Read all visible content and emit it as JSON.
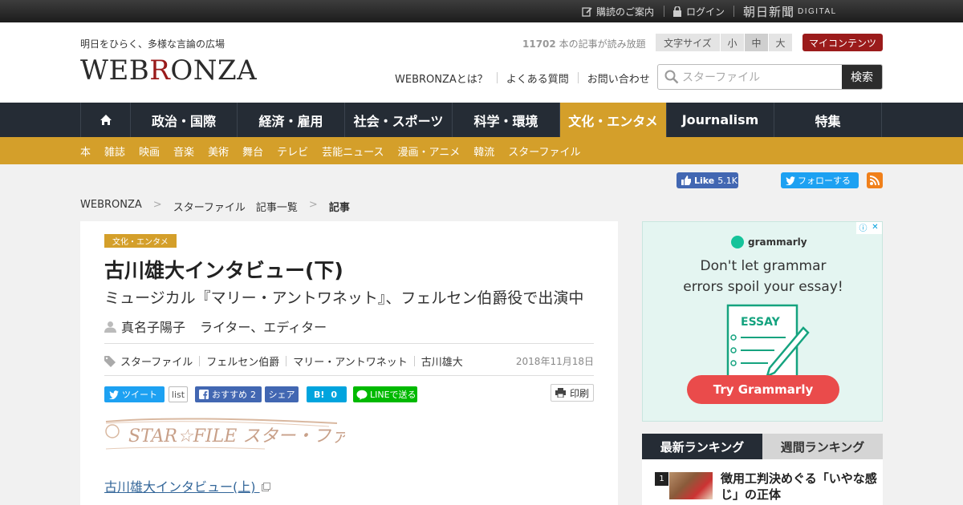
{
  "topbar": {
    "subscribe": "購読のご案内",
    "login": "ログイン",
    "brand": "朝日新聞",
    "brand_sub": "DIGITAL"
  },
  "header": {
    "tagline": "明日をひらく、多様な言論の広場",
    "logo_pre": "WEB",
    "logo_r": "R",
    "logo_post": "ONZA",
    "count_num": "11702",
    "count_text": " 本の記事が読み放題",
    "fontsize": {
      "label": "文字サイズ",
      "small": "小",
      "medium": "中",
      "large": "大"
    },
    "mycontents": "マイコンテンツ",
    "links": [
      "WEBRONZAとは？",
      "よくある質問",
      "お問い合わせ"
    ],
    "search": {
      "placeholder": "スターファイル",
      "button": "検索"
    }
  },
  "nav": {
    "items": [
      "政治・国際",
      "経済・雇用",
      "社会・スポーツ",
      "科学・環境",
      "文化・エンタメ",
      "Journalism",
      "特集"
    ],
    "active": "文化・エンタメ"
  },
  "subnav": [
    "本",
    "雑誌",
    "映画",
    "音楽",
    "美術",
    "舞台",
    "テレビ",
    "芸能ニュース",
    "漫画・アニメ",
    "韓流",
    "スターファイル"
  ],
  "social": {
    "like": "Like",
    "like_count": "5.1K",
    "follow": "フォローする"
  },
  "breadcrumb": {
    "home": "WEBRONZA",
    "section": "スターファイル　記事一覧",
    "current": "記事",
    "sep": ">"
  },
  "article": {
    "category": "文化・エンタメ",
    "title": "古川雄大インタビュー(下)",
    "subtitle": "ミュージカル『マリー・アントワネット』、フェルセン伯爵役で出演中",
    "author": "真名子陽子",
    "author_role": "ライター、エディター",
    "tags": [
      "スターファイル",
      "フェルセン伯爵",
      "マリー・アントワネット",
      "古川雄大"
    ],
    "date": "2018年11月18日",
    "share": {
      "tweet": "ツイート",
      "tweet_count": "list",
      "recommend": "おすすめ",
      "recommend_count": "2",
      "share": "シェア",
      "hatena": "B!",
      "hatena_count": "0",
      "line": "LINEで送る",
      "print": "印刷"
    },
    "starfile_logo": "STAR☆FILE スター・ファイル",
    "link": "古川雄大インタビュー(上)"
  },
  "ad": {
    "brand": "grammarly",
    "headline_1": "Don't let grammar",
    "headline_2": "errors spoil your essay!",
    "essay": "ESSAY",
    "button": "Try Grammarly"
  },
  "ranking": {
    "tab_latest": "最新ランキング",
    "tab_weekly": "週間ランキング",
    "items": [
      {
        "rank": "1",
        "title": "徴用工判決めぐる「いやな感じ」の正体"
      }
    ]
  },
  "colors": {
    "accent": "#d49f2a",
    "nav": "#252c35",
    "brand_red": "#9b1b1b"
  }
}
